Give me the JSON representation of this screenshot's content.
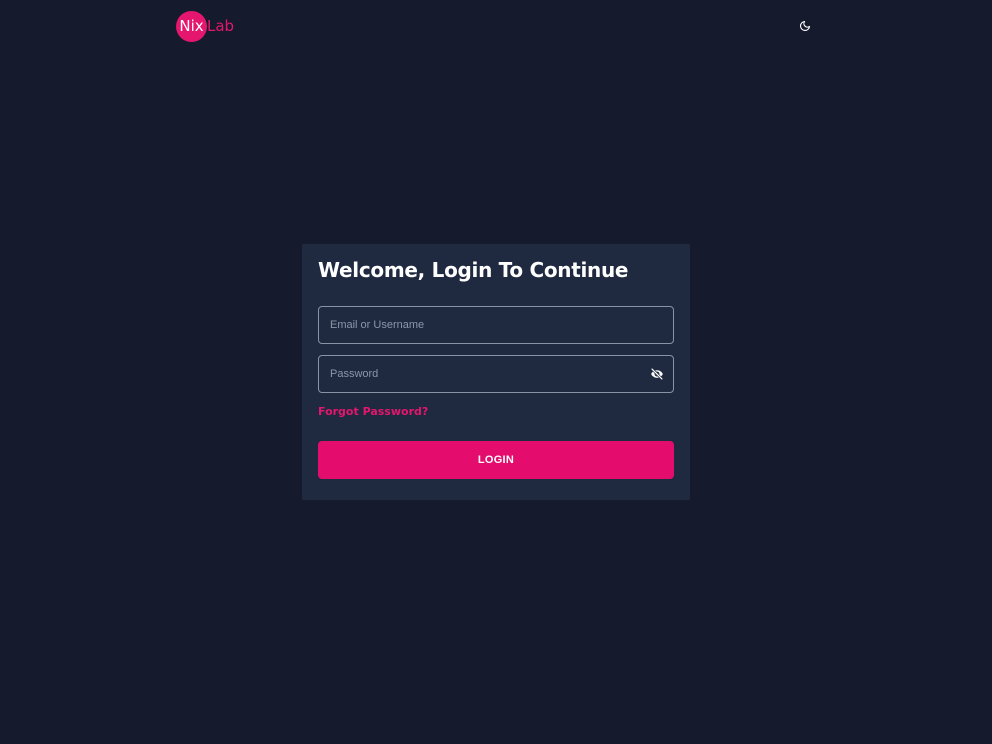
{
  "header": {
    "logo": {
      "part1": "Nix",
      "part2": "Lab"
    },
    "theme_toggle_icon": "moon-icon"
  },
  "login_card": {
    "title": "Welcome, Login To Continue",
    "email_field": {
      "placeholder": "Email or Username",
      "value": ""
    },
    "password_field": {
      "placeholder": "Password",
      "value": "",
      "toggle_icon": "eye-off-icon"
    },
    "forgot_password_label": "Forgot Password?",
    "login_label": "LOGIN"
  },
  "colors": {
    "background": "#151a2c",
    "card": "#1f2940",
    "accent": "#e40c6c",
    "field_border": "#8a93a6"
  }
}
